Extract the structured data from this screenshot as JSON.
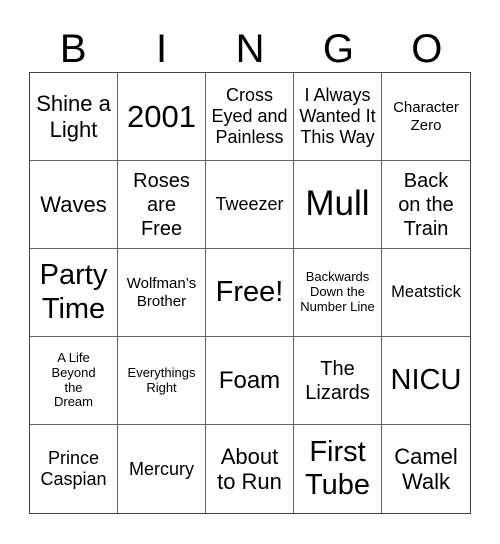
{
  "header": {
    "letters": [
      "B",
      "I",
      "N",
      "G",
      "O"
    ]
  },
  "cells": [
    "Shine a Light",
    "2001",
    "Cross Eyed and Painless",
    "I Always Wanted It This Way",
    "Character Zero",
    "Waves",
    "Roses are Free",
    "Tweezer",
    "Mull",
    "Back on the Train",
    "Party Time",
    "Wolfman’s Brother",
    "Free!",
    "Backwards Down the Number Line",
    "Meatstick",
    "A Life Beyond the Dream",
    "Everythings Right",
    "Foam",
    "The Lizards",
    "NICU",
    "Prince Caspian",
    "Mercury",
    "About to Run",
    "First Tube",
    "Camel Walk"
  ]
}
